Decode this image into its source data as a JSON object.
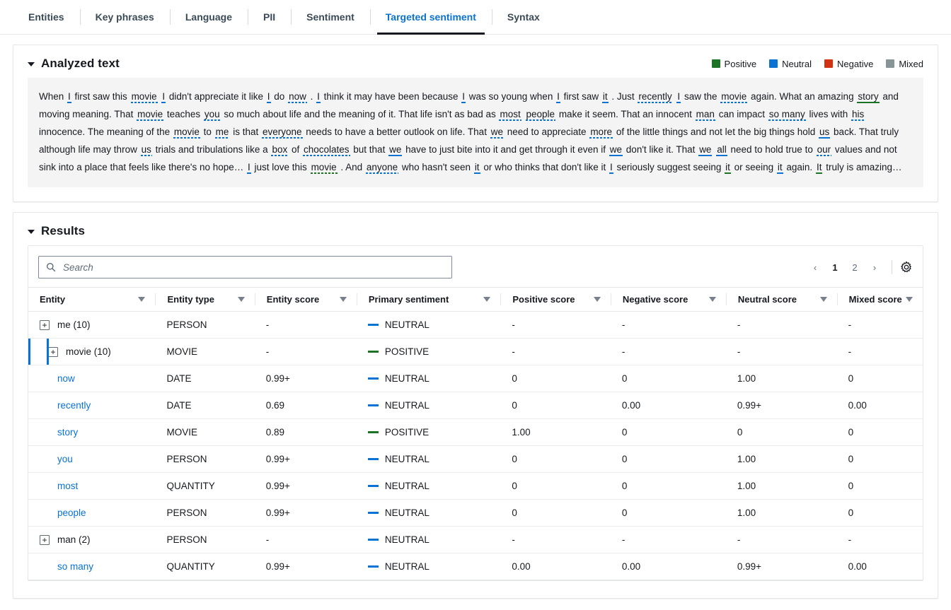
{
  "tabs": [
    {
      "label": "Entities",
      "active": false
    },
    {
      "label": "Key phrases",
      "active": false
    },
    {
      "label": "Language",
      "active": false
    },
    {
      "label": "PII",
      "active": false
    },
    {
      "label": "Sentiment",
      "active": false
    },
    {
      "label": "Targeted sentiment",
      "active": true
    },
    {
      "label": "Syntax",
      "active": false
    }
  ],
  "analyzed": {
    "title": "Analyzed text",
    "legend": [
      {
        "label": "Positive",
        "color": "#1d7324"
      },
      {
        "label": "Neutral",
        "color": "#0972d3"
      },
      {
        "label": "Negative",
        "color": "#d13212"
      },
      {
        "label": "Mixed",
        "color": "#879596"
      }
    ],
    "tokens": [
      {
        "t": "When ",
        "s": "plain"
      },
      {
        "t": "I",
        "s": "neu-s"
      },
      {
        "t": " first saw this ",
        "s": "plain"
      },
      {
        "t": "movie",
        "s": "neu-d"
      },
      {
        "t": " ",
        "s": "plain"
      },
      {
        "t": "I",
        "s": "neu-s"
      },
      {
        "t": " didn't appreciate it like ",
        "s": "plain"
      },
      {
        "t": "I",
        "s": "neu-s"
      },
      {
        "t": " do ",
        "s": "plain"
      },
      {
        "t": "now",
        "s": "neu-d"
      },
      {
        "t": " . ",
        "s": "plain"
      },
      {
        "t": "I",
        "s": "neu-s"
      },
      {
        "t": " think it may have been because ",
        "s": "plain"
      },
      {
        "t": "I",
        "s": "neu-s"
      },
      {
        "t": " was so young when ",
        "s": "plain"
      },
      {
        "t": "I",
        "s": "neu-s"
      },
      {
        "t": " first saw ",
        "s": "plain"
      },
      {
        "t": "it",
        "s": "neu-s"
      },
      {
        "t": " . Just ",
        "s": "plain"
      },
      {
        "t": "recently",
        "s": "neu-d"
      },
      {
        "t": " ",
        "s": "plain"
      },
      {
        "t": "I",
        "s": "neu-s"
      },
      {
        "t": " saw the ",
        "s": "plain"
      },
      {
        "t": "movie",
        "s": "neu-d"
      },
      {
        "t": " again. What an amazing ",
        "s": "plain"
      },
      {
        "t": "story",
        "s": "pos-s"
      },
      {
        "t": " and moving meaning. That ",
        "s": "plain"
      },
      {
        "t": "movie",
        "s": "neu-d"
      },
      {
        "t": " teaches ",
        "s": "plain"
      },
      {
        "t": "you",
        "s": "neu-d"
      },
      {
        "t": " so much about life and the meaning of it. That life isn't as bad as ",
        "s": "plain"
      },
      {
        "t": "most",
        "s": "neu-d"
      },
      {
        "t": " ",
        "s": "plain"
      },
      {
        "t": "people",
        "s": "neu-d"
      },
      {
        "t": " make it seem. That an innocent ",
        "s": "plain"
      },
      {
        "t": "man",
        "s": "neu-d"
      },
      {
        "t": " can impact ",
        "s": "plain"
      },
      {
        "t": "so many",
        "s": "neu-d"
      },
      {
        "t": " lives with ",
        "s": "plain"
      },
      {
        "t": "his",
        "s": "neu-d"
      },
      {
        "t": " innocence. The meaning of the ",
        "s": "plain"
      },
      {
        "t": "movie",
        "s": "neu-d"
      },
      {
        "t": " to ",
        "s": "plain"
      },
      {
        "t": "me",
        "s": "neu-d"
      },
      {
        "t": " is that ",
        "s": "plain"
      },
      {
        "t": "everyone",
        "s": "neu-d"
      },
      {
        "t": " needs to have a better outlook on life. That ",
        "s": "plain"
      },
      {
        "t": "we",
        "s": "neu-d"
      },
      {
        "t": " need to appreciate ",
        "s": "plain"
      },
      {
        "t": "more",
        "s": "neu-d"
      },
      {
        "t": " of the little things and not let the big things hold ",
        "s": "plain"
      },
      {
        "t": "us",
        "s": "neu-s"
      },
      {
        "t": " back. That truly although life may throw ",
        "s": "plain"
      },
      {
        "t": "us",
        "s": "neu-d"
      },
      {
        "t": " trials and tribulations like a ",
        "s": "plain"
      },
      {
        "t": "box",
        "s": "neu-d"
      },
      {
        "t": " of ",
        "s": "plain"
      },
      {
        "t": "chocolates",
        "s": "neu-d"
      },
      {
        "t": " but that ",
        "s": "plain"
      },
      {
        "t": "we",
        "s": "neu-s"
      },
      {
        "t": " have to just bite into it and get through it even if ",
        "s": "plain"
      },
      {
        "t": "we",
        "s": "neu-s"
      },
      {
        "t": " don't like it. That ",
        "s": "plain"
      },
      {
        "t": "we",
        "s": "neu-s"
      },
      {
        "t": " ",
        "s": "plain"
      },
      {
        "t": "all",
        "s": "neu-s"
      },
      {
        "t": " need to hold true to ",
        "s": "plain"
      },
      {
        "t": "our",
        "s": "neu-d"
      },
      {
        "t": " values and not sink into a place that feels like there's no hope… ",
        "s": "plain"
      },
      {
        "t": "I",
        "s": "neu-s"
      },
      {
        "t": " just love this ",
        "s": "plain"
      },
      {
        "t": "movie",
        "s": "pos-d"
      },
      {
        "t": " . And ",
        "s": "plain"
      },
      {
        "t": "anyone",
        "s": "neu-d"
      },
      {
        "t": " who hasn't seen ",
        "s": "plain"
      },
      {
        "t": "it",
        "s": "neu-s"
      },
      {
        "t": " or who thinks that don't like it ",
        "s": "plain"
      },
      {
        "t": "I",
        "s": "neu-s"
      },
      {
        "t": " seriously suggest seeing ",
        "s": "plain"
      },
      {
        "t": "it",
        "s": "pos-s"
      },
      {
        "t": " or seeing ",
        "s": "plain"
      },
      {
        "t": "it",
        "s": "neu-s"
      },
      {
        "t": " again. ",
        "s": "plain"
      },
      {
        "t": "It",
        "s": "pos-s"
      },
      {
        "t": " truly is amazing…",
        "s": "plain"
      }
    ]
  },
  "results": {
    "title": "Results",
    "search": {
      "value": "",
      "placeholder": "Search"
    },
    "pagination": {
      "prev": "‹",
      "pages": [
        "1",
        "2"
      ],
      "current": "1",
      "next": "›"
    },
    "columns": [
      "Entity",
      "Entity type",
      "Entity score",
      "Primary sentiment",
      "Positive score",
      "Negative score",
      "Neutral score",
      "Mixed score"
    ],
    "rows": [
      {
        "entity": "me (10)",
        "expandable": true,
        "child": false,
        "selected": false,
        "type": "PERSON",
        "score": "-",
        "sentiment": "NEUTRAL",
        "sentiment_color": "#0972d3",
        "positive": "-",
        "negative": "-",
        "neutral": "-",
        "mixed": "-"
      },
      {
        "entity": "movie (10)",
        "expandable": true,
        "child": false,
        "selected": true,
        "type": "MOVIE",
        "score": "-",
        "sentiment": "POSITIVE",
        "sentiment_color": "#1d7324",
        "positive": "-",
        "negative": "-",
        "neutral": "-",
        "mixed": "-"
      },
      {
        "entity": "now",
        "expandable": false,
        "child": true,
        "selected": false,
        "type": "DATE",
        "score": "0.99+",
        "sentiment": "NEUTRAL",
        "sentiment_color": "#0972d3",
        "positive": "0",
        "negative": "0",
        "neutral": "1.00",
        "mixed": "0"
      },
      {
        "entity": "recently",
        "expandable": false,
        "child": true,
        "selected": false,
        "type": "DATE",
        "score": "0.69",
        "sentiment": "NEUTRAL",
        "sentiment_color": "#0972d3",
        "positive": "0",
        "negative": "0.00",
        "neutral": "0.99+",
        "mixed": "0.00"
      },
      {
        "entity": "story",
        "expandable": false,
        "child": true,
        "selected": false,
        "type": "MOVIE",
        "score": "0.89",
        "sentiment": "POSITIVE",
        "sentiment_color": "#1d7324",
        "positive": "1.00",
        "negative": "0",
        "neutral": "0",
        "mixed": "0"
      },
      {
        "entity": "you",
        "expandable": false,
        "child": true,
        "selected": false,
        "type": "PERSON",
        "score": "0.99+",
        "sentiment": "NEUTRAL",
        "sentiment_color": "#0972d3",
        "positive": "0",
        "negative": "0",
        "neutral": "1.00",
        "mixed": "0"
      },
      {
        "entity": "most",
        "expandable": false,
        "child": true,
        "selected": false,
        "type": "QUANTITY",
        "score": "0.99+",
        "sentiment": "NEUTRAL",
        "sentiment_color": "#0972d3",
        "positive": "0",
        "negative": "0",
        "neutral": "1.00",
        "mixed": "0"
      },
      {
        "entity": "people",
        "expandable": false,
        "child": true,
        "selected": false,
        "type": "PERSON",
        "score": "0.99+",
        "sentiment": "NEUTRAL",
        "sentiment_color": "#0972d3",
        "positive": "0",
        "negative": "0",
        "neutral": "1.00",
        "mixed": "0"
      },
      {
        "entity": "man (2)",
        "expandable": true,
        "child": false,
        "selected": false,
        "type": "PERSON",
        "score": "-",
        "sentiment": "NEUTRAL",
        "sentiment_color": "#0972d3",
        "positive": "-",
        "negative": "-",
        "neutral": "-",
        "mixed": "-"
      },
      {
        "entity": "so many",
        "expandable": false,
        "child": true,
        "selected": false,
        "type": "QUANTITY",
        "score": "0.99+",
        "sentiment": "NEUTRAL",
        "sentiment_color": "#0972d3",
        "positive": "0.00",
        "negative": "0.00",
        "neutral": "0.99+",
        "mixed": "0.00"
      }
    ]
  }
}
